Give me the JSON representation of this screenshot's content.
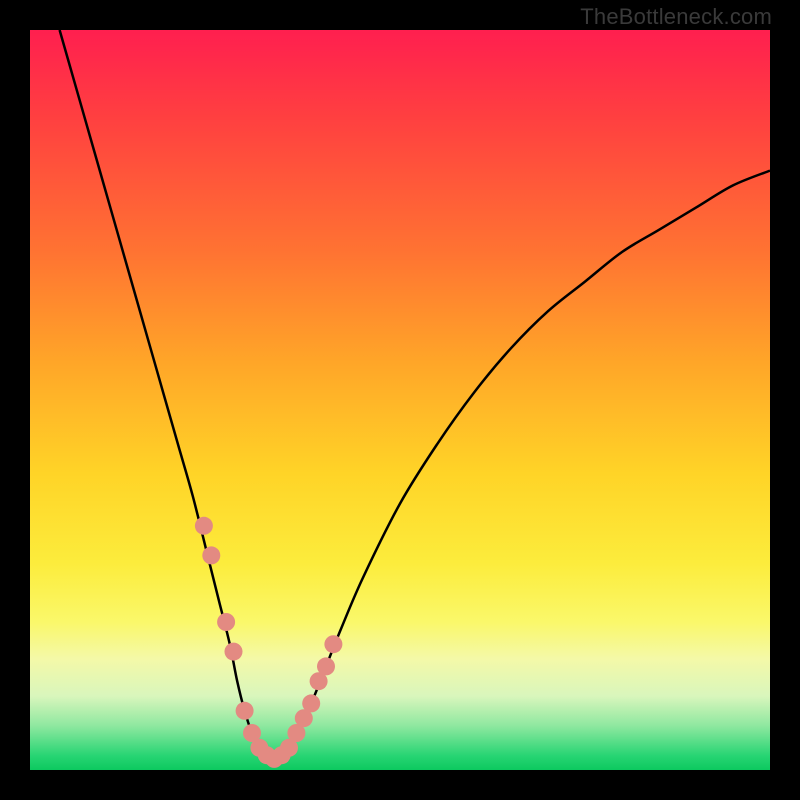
{
  "watermark": "TheBottleneck.com",
  "colors": {
    "curve": "#000000",
    "dot_fill": "#e38a82",
    "frame": "#000000"
  },
  "chart_data": {
    "type": "line",
    "title": "",
    "xlabel": "",
    "ylabel": "",
    "xlim": [
      0,
      100
    ],
    "ylim": [
      0,
      100
    ],
    "series": [
      {
        "name": "bottleneck-curve",
        "x": [
          4,
          6,
          8,
          10,
          12,
          14,
          16,
          18,
          20,
          22,
          24,
          25.5,
          27,
          28,
          29,
          30,
          31,
          32,
          33,
          34,
          35,
          36,
          38,
          40,
          42,
          45,
          50,
          55,
          60,
          65,
          70,
          75,
          80,
          85,
          90,
          95,
          100
        ],
        "y": [
          100,
          93,
          86,
          79,
          72,
          65,
          58,
          51,
          44,
          37,
          29,
          23,
          17,
          12,
          8,
          5,
          3,
          2,
          1.5,
          2,
          3,
          5,
          9,
          14,
          19,
          26,
          36,
          44,
          51,
          57,
          62,
          66,
          70,
          73,
          76,
          79,
          81
        ]
      }
    ],
    "highlight_points": {
      "name": "highlighted-dots",
      "x": [
        23.5,
        24.5,
        26.5,
        27.5,
        29,
        30,
        31,
        32,
        33,
        34,
        35,
        36,
        37,
        38,
        39,
        40,
        41
      ],
      "y": [
        33,
        29,
        20,
        16,
        8,
        5,
        3,
        2,
        1.5,
        2,
        3,
        5,
        7,
        9,
        12,
        14,
        17
      ]
    }
  }
}
